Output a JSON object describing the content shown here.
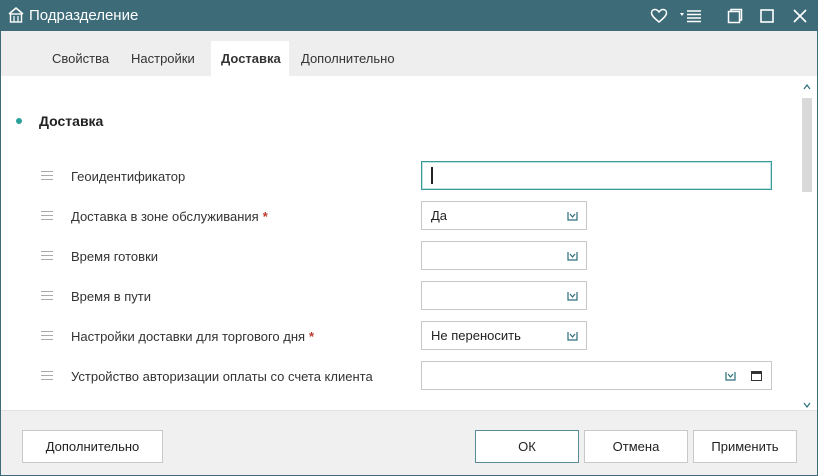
{
  "window": {
    "title": "Подразделение",
    "title_icon": "building-icon"
  },
  "titlebar_buttons": [
    {
      "name": "favorite-button",
      "icon": "heart-icon"
    },
    {
      "name": "more-menu-button",
      "icon": "menu-icon"
    },
    {
      "name": "restore-button",
      "icon": "restore-icon"
    },
    {
      "name": "maximize-button",
      "icon": "maximize-icon"
    },
    {
      "name": "close-button",
      "icon": "close-icon"
    }
  ],
  "tabs": [
    {
      "label": "Свойства",
      "active": false
    },
    {
      "label": "Настройки",
      "active": false
    },
    {
      "label": "Доставка",
      "active": true
    },
    {
      "label": "Дополнительно",
      "active": false
    }
  ],
  "section": {
    "title": "Доставка"
  },
  "fields": [
    {
      "label": "Геоидентификатор",
      "required": false,
      "value": ""
    },
    {
      "label": "Доставка в зоне обслуживания",
      "required": true,
      "value": "Да"
    },
    {
      "label": "Время готовки",
      "required": false,
      "value": ""
    },
    {
      "label": "Время в пути",
      "required": false,
      "value": ""
    },
    {
      "label": "Настройки доставки для торгового дня",
      "required": true,
      "value": "Не переносить"
    },
    {
      "label": "Устройство авторизации оплаты со счета клиента",
      "required": false,
      "value": ""
    }
  ],
  "required_mark": "*",
  "footer": {
    "more_label": "Дополнительно",
    "ok_label": "ОК",
    "cancel_label": "Отмена",
    "apply_label": "Применить"
  },
  "colors": {
    "titlebar": "#3d6b78",
    "accent": "#2aa198",
    "required": "#c0392b"
  }
}
